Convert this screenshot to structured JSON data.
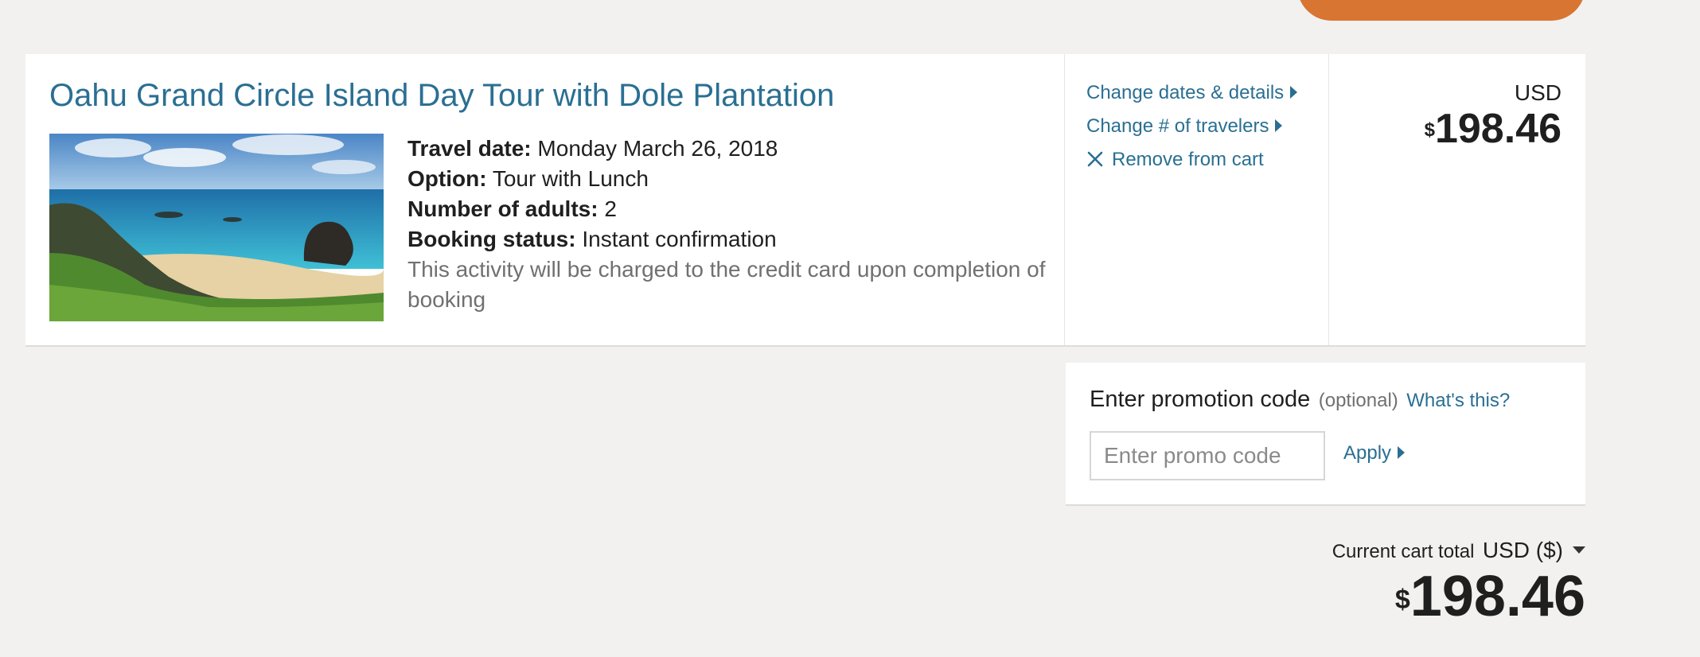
{
  "item": {
    "title": "Oahu Grand Circle Island Day Tour with Dole Plantation",
    "details": {
      "travel_date_label": "Travel date:",
      "travel_date_value": "Monday March 26, 2018",
      "option_label": "Option:",
      "option_value": "Tour with Lunch",
      "adults_label": "Number of adults:",
      "adults_value": "2",
      "status_label": "Booking status:",
      "status_value": "Instant confirmation",
      "charge_note": "This activity will be charged to the credit card upon completion of booking"
    },
    "actions": {
      "change_dates": "Change dates & details",
      "change_travelers": "Change # of travelers",
      "remove": "Remove from cart"
    },
    "price": {
      "currency": "USD",
      "symbol": "$",
      "amount": "198.46"
    }
  },
  "promo": {
    "label": "Enter promotion code",
    "optional": "(optional)",
    "help_link": "What's this?",
    "placeholder": "Enter promo code",
    "value": "",
    "apply": "Apply"
  },
  "cart_total": {
    "label": "Current cart total",
    "currency": "USD ($)",
    "symbol": "$",
    "amount": "198.46"
  },
  "colors": {
    "background": "#f2f1ef",
    "link": "#2a6f93",
    "cta": "#d87532",
    "muted_text": "#707070"
  }
}
